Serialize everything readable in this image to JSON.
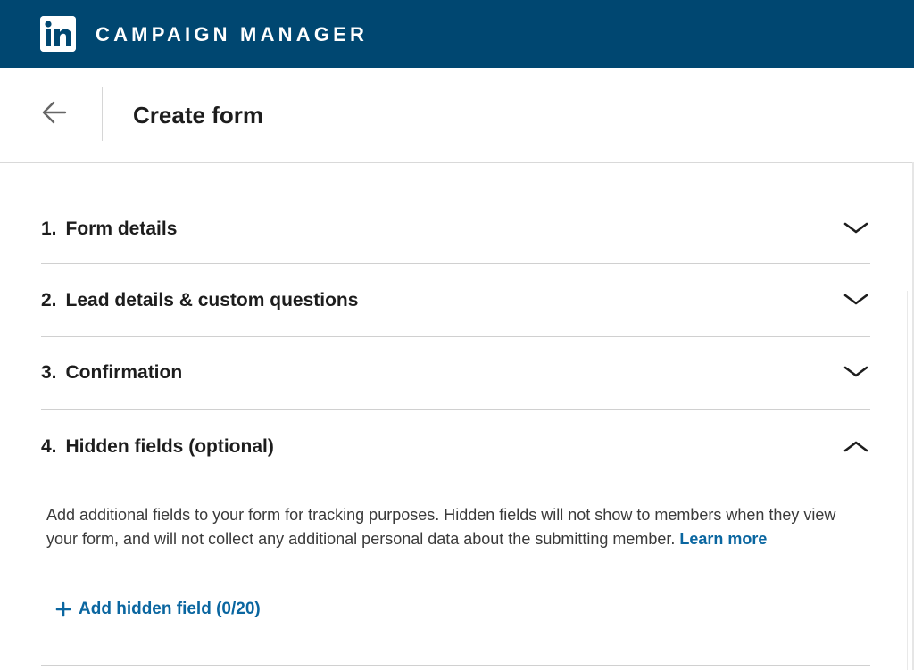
{
  "topbar": {
    "brand_icon": "linkedin-logo-icon",
    "app_title": "CAMPAIGN MANAGER",
    "background_color": "#004771"
  },
  "header": {
    "back_icon": "arrow-left-icon",
    "title": "Create form"
  },
  "sections": [
    {
      "number": "1.",
      "label": "Form details",
      "expanded": false,
      "icon": "chevron-down-icon"
    },
    {
      "number": "2.",
      "label": "Lead details & custom questions",
      "expanded": false,
      "icon": "chevron-down-icon"
    },
    {
      "number": "3.",
      "label": "Confirmation",
      "expanded": false,
      "icon": "chevron-down-icon"
    },
    {
      "number": "4.",
      "label": "Hidden fields (optional)",
      "expanded": true,
      "icon": "chevron-up-icon"
    }
  ],
  "hidden_fields": {
    "description": "Add additional fields to your form for tracking purposes. Hidden fields will not show to members when they view your form, and will not collect any additional personal data about the submitting member.",
    "learn_more": "Learn more",
    "add_button": "Add hidden field (0/20)",
    "add_icon": "plus-icon",
    "link_color": "#0a66a0"
  }
}
